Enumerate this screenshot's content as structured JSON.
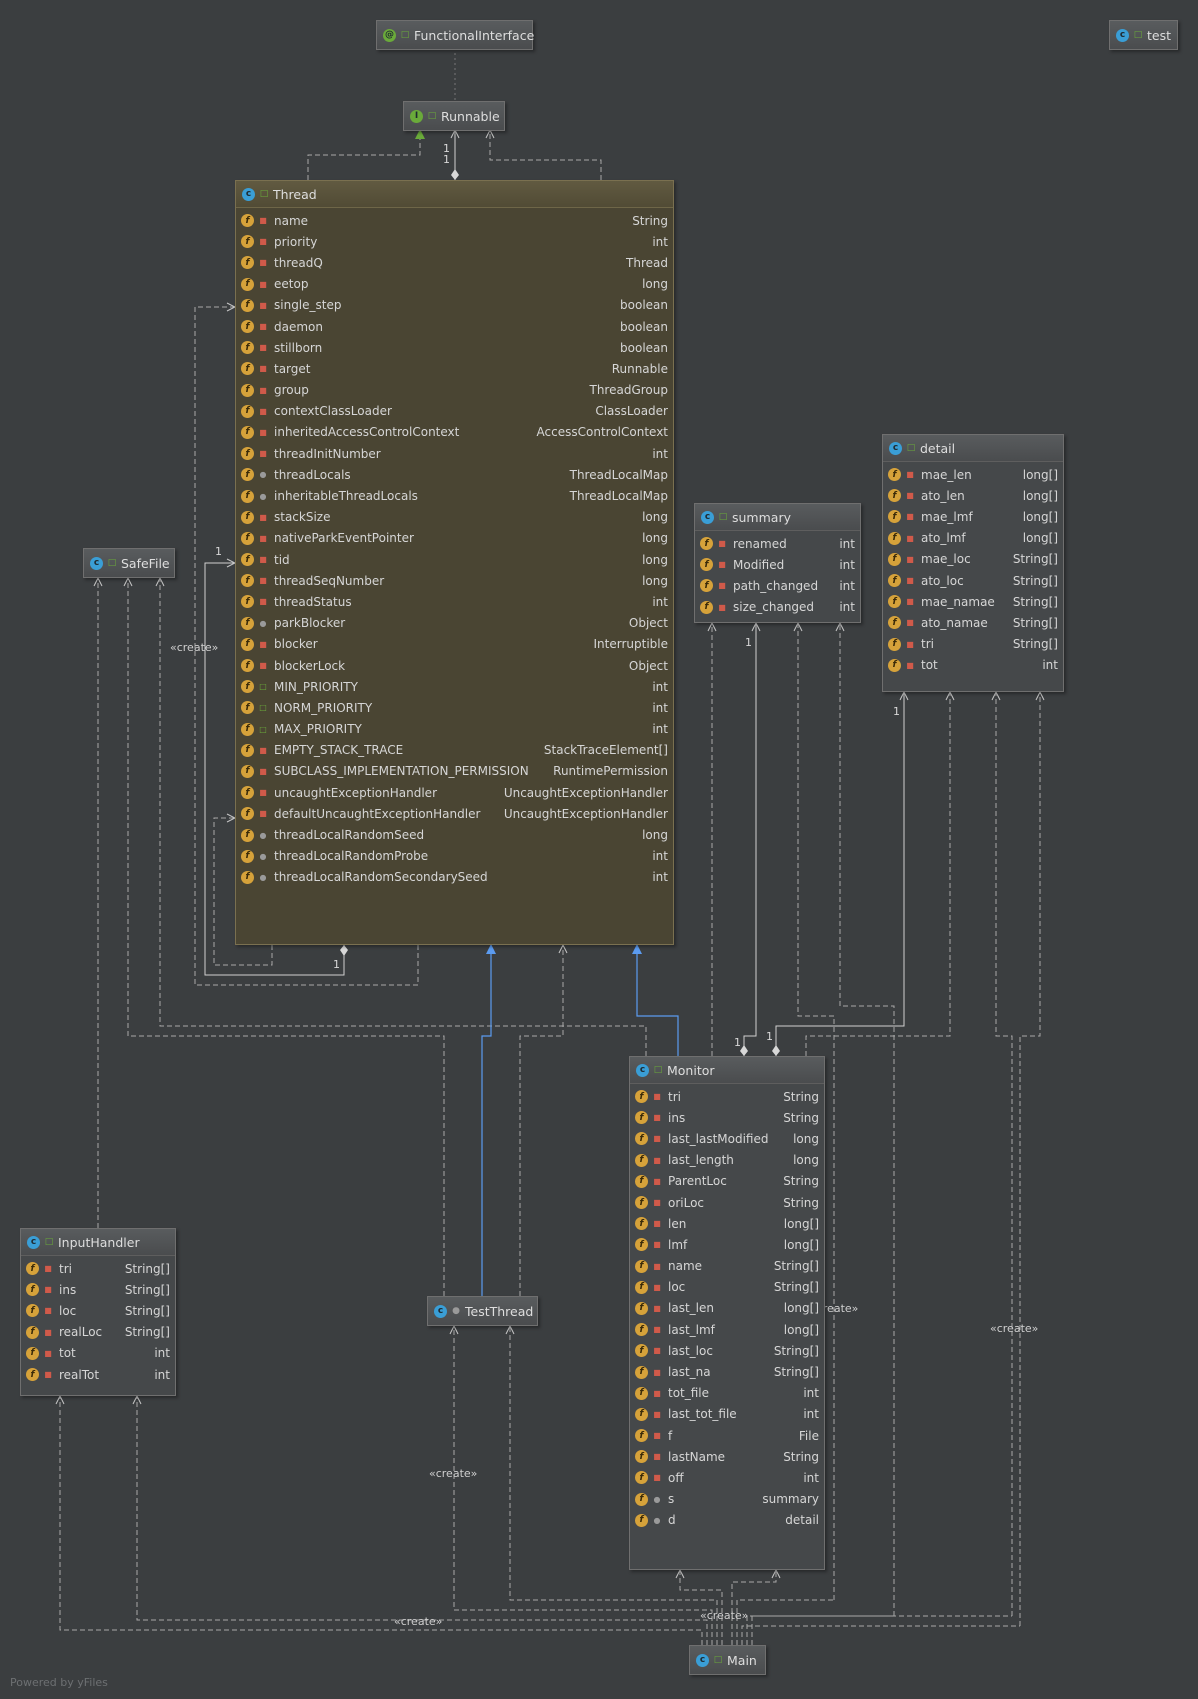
{
  "diagram": {
    "nodes": [
      {
        "id": "functionalinterface",
        "kind": "annotation",
        "visibility": "pub",
        "title": "FunctionalInterface",
        "fields": []
      },
      {
        "id": "test",
        "kind": "class",
        "visibility": "pub",
        "title": "test",
        "fields": []
      },
      {
        "id": "runnable",
        "kind": "interface",
        "visibility": "pub",
        "title": "Runnable",
        "fields": []
      },
      {
        "id": "thread",
        "kind": "class",
        "visibility": "pub",
        "title": "Thread",
        "fields": [
          {
            "name": "name",
            "type": "String",
            "access": "private"
          },
          {
            "name": "priority",
            "type": "int",
            "access": "private"
          },
          {
            "name": "threadQ",
            "type": "Thread",
            "access": "private"
          },
          {
            "name": "eetop",
            "type": "long",
            "access": "private"
          },
          {
            "name": "single_step",
            "type": "boolean",
            "access": "private"
          },
          {
            "name": "daemon",
            "type": "boolean",
            "access": "private"
          },
          {
            "name": "stillborn",
            "type": "boolean",
            "access": "private"
          },
          {
            "name": "target",
            "type": "Runnable",
            "access": "private"
          },
          {
            "name": "group",
            "type": "ThreadGroup",
            "access": "private"
          },
          {
            "name": "contextClassLoader",
            "type": "ClassLoader",
            "access": "private"
          },
          {
            "name": "inheritedAccessControlContext",
            "type": "AccessControlContext",
            "access": "private"
          },
          {
            "name": "threadInitNumber",
            "type": "int",
            "access": "private"
          },
          {
            "name": "threadLocals",
            "type": "ThreadLocalMap",
            "access": "package"
          },
          {
            "name": "inheritableThreadLocals",
            "type": "ThreadLocalMap",
            "access": "package"
          },
          {
            "name": "stackSize",
            "type": "long",
            "access": "private"
          },
          {
            "name": "nativeParkEventPointer",
            "type": "long",
            "access": "private"
          },
          {
            "name": "tid",
            "type": "long",
            "access": "private"
          },
          {
            "name": "threadSeqNumber",
            "type": "long",
            "access": "private"
          },
          {
            "name": "threadStatus",
            "type": "int",
            "access": "private"
          },
          {
            "name": "parkBlocker",
            "type": "Object",
            "access": "package"
          },
          {
            "name": "blocker",
            "type": "Interruptible",
            "access": "private"
          },
          {
            "name": "blockerLock",
            "type": "Object",
            "access": "private"
          },
          {
            "name": "MIN_PRIORITY",
            "type": "int",
            "access": "public"
          },
          {
            "name": "NORM_PRIORITY",
            "type": "int",
            "access": "public"
          },
          {
            "name": "MAX_PRIORITY",
            "type": "int",
            "access": "public"
          },
          {
            "name": "EMPTY_STACK_TRACE",
            "type": "StackTraceElement[]",
            "access": "private"
          },
          {
            "name": "SUBCLASS_IMPLEMENTATION_PERMISSION",
            "type": "RuntimePermission",
            "access": "private"
          },
          {
            "name": "uncaughtExceptionHandler",
            "type": "UncaughtExceptionHandler",
            "access": "private"
          },
          {
            "name": "defaultUncaughtExceptionHandler",
            "type": "UncaughtExceptionHandler",
            "access": "private"
          },
          {
            "name": "threadLocalRandomSeed",
            "type": "long",
            "access": "package"
          },
          {
            "name": "threadLocalRandomProbe",
            "type": "int",
            "access": "package"
          },
          {
            "name": "threadLocalRandomSecondarySeed",
            "type": "int",
            "access": "package"
          }
        ]
      },
      {
        "id": "safefile",
        "kind": "class",
        "visibility": "pub",
        "title": "SafeFile",
        "fields": []
      },
      {
        "id": "summary",
        "kind": "class",
        "visibility": "pub",
        "title": "summary",
        "fields": [
          {
            "name": "renamed",
            "type": "int",
            "access": "private"
          },
          {
            "name": "Modified",
            "type": "int",
            "access": "private"
          },
          {
            "name": "path_changed",
            "type": "int",
            "access": "private"
          },
          {
            "name": "size_changed",
            "type": "int",
            "access": "private"
          }
        ]
      },
      {
        "id": "detail",
        "kind": "class",
        "visibility": "pub",
        "title": "detail",
        "fields": [
          {
            "name": "mae_len",
            "type": "long[]",
            "access": "private"
          },
          {
            "name": "ato_len",
            "type": "long[]",
            "access": "private"
          },
          {
            "name": "mae_lmf",
            "type": "long[]",
            "access": "private"
          },
          {
            "name": "ato_lmf",
            "type": "long[]",
            "access": "private"
          },
          {
            "name": "mae_loc",
            "type": "String[]",
            "access": "private"
          },
          {
            "name": "ato_loc",
            "type": "String[]",
            "access": "private"
          },
          {
            "name": "mae_namae",
            "type": "String[]",
            "access": "private"
          },
          {
            "name": "ato_namae",
            "type": "String[]",
            "access": "private"
          },
          {
            "name": "tri",
            "type": "String[]",
            "access": "private"
          },
          {
            "name": "tot",
            "type": "int",
            "access": "private"
          }
        ]
      },
      {
        "id": "monitor",
        "kind": "class",
        "visibility": "pub",
        "title": "Monitor",
        "fields": [
          {
            "name": "tri",
            "type": "String",
            "access": "private"
          },
          {
            "name": "ins",
            "type": "String",
            "access": "private"
          },
          {
            "name": "last_lastModified",
            "type": "long",
            "access": "private"
          },
          {
            "name": "last_length",
            "type": "long",
            "access": "private"
          },
          {
            "name": "ParentLoc",
            "type": "String",
            "access": "private"
          },
          {
            "name": "oriLoc",
            "type": "String",
            "access": "private"
          },
          {
            "name": "len",
            "type": "long[]",
            "access": "private"
          },
          {
            "name": "lmf",
            "type": "long[]",
            "access": "private"
          },
          {
            "name": "name",
            "type": "String[]",
            "access": "private"
          },
          {
            "name": "loc",
            "type": "String[]",
            "access": "private"
          },
          {
            "name": "last_len",
            "type": "long[]",
            "access": "private"
          },
          {
            "name": "last_lmf",
            "type": "long[]",
            "access": "private"
          },
          {
            "name": "last_loc",
            "type": "String[]",
            "access": "private"
          },
          {
            "name": "last_na",
            "type": "String[]",
            "access": "private"
          },
          {
            "name": "tot_file",
            "type": "int",
            "access": "private"
          },
          {
            "name": "last_tot_file",
            "type": "int",
            "access": "private"
          },
          {
            "name": "f",
            "type": "File",
            "access": "private"
          },
          {
            "name": "lastName",
            "type": "String",
            "access": "private"
          },
          {
            "name": "off",
            "type": "int",
            "access": "private"
          },
          {
            "name": "s",
            "type": "summary",
            "access": "package"
          },
          {
            "name": "d",
            "type": "detail",
            "access": "package"
          }
        ]
      },
      {
        "id": "inputhandler",
        "kind": "class",
        "visibility": "pub",
        "title": "InputHandler",
        "fields": [
          {
            "name": "tri",
            "type": "String[]",
            "access": "private"
          },
          {
            "name": "ins",
            "type": "String[]",
            "access": "private"
          },
          {
            "name": "loc",
            "type": "String[]",
            "access": "private"
          },
          {
            "name": "realLoc",
            "type": "String[]",
            "access": "private"
          },
          {
            "name": "tot",
            "type": "int",
            "access": "private"
          },
          {
            "name": "realTot",
            "type": "int",
            "access": "private"
          }
        ]
      },
      {
        "id": "testthread",
        "kind": "class",
        "visibility": "pkg",
        "title": "TestThread",
        "fields": []
      },
      {
        "id": "main",
        "kind": "class",
        "visibility": "pub",
        "title": "Main",
        "fields": []
      }
    ],
    "edge_labels": {
      "create_thread": "«create»",
      "create_monitor": "«create»",
      "create_testthread": "«create»",
      "create_detail": "«create»",
      "create_main_a": "«create»",
      "create_main_b": "«create»"
    },
    "multiplicities": {
      "runnable_1": "1",
      "runnable_2": "1",
      "thread_self_1": "1",
      "thread_self_2": "1",
      "summary_1": "1",
      "detail_1": "1",
      "monitor_1a": "1",
      "monitor_1b": "1"
    },
    "footer": "Powered by yFiles"
  }
}
